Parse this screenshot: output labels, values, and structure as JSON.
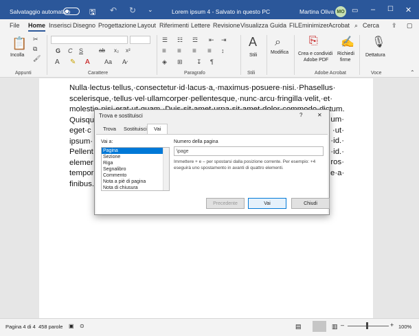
{
  "titlebar": {
    "autosave_label": "Salvataggio automatico",
    "doc_title": "Lorem ipsum 4  -  Salvato in questo PC",
    "user_name": "Martina Oliva",
    "user_initials": "MO"
  },
  "tabs": [
    "File",
    "Home",
    "Inserisci",
    "Disegno",
    "Progettazione",
    "Layout",
    "Riferimenti",
    "Lettere",
    "Revisione",
    "Visualizza",
    "Guida",
    "FILEminimizer",
    "Acrobat",
    "Cerca"
  ],
  "active_tab": "Home",
  "ribbon": {
    "paste_label": "Incolla",
    "groups": {
      "clipboard": "Appunti",
      "font": "Carattere",
      "paragraph": "Paragrafo",
      "styles_grp": "Stili",
      "acrobat": "Adobe Acrobat",
      "voice": "Voce"
    },
    "styles_label": "Stili",
    "edit_label": "Modifica",
    "create_pdf": "Crea e condividi",
    "create_pdf2": "Adobe PDF",
    "request_sign": "Richiedi",
    "request_sign2": "firme",
    "dictate": "Dettatura"
  },
  "document": {
    "lines": [
      "Nulla·lectus·tellus,·consectetur·id·lacus·a,·maximus·posuere·nisi.·Phasellus·",
      "scelerisque,·tellus·vel·ullamcorper·pellentesque,·nunc·arcu·fringilla·velit,·et·",
      "molestie·nisi·erat·ut·quam.·Duis·sit·amet·urna·sit·amet·dolor·commodo·dictum.·",
      "Quisque",
      "eget·c",
      "ipsum·",
      "Pellent",
      "elemer",
      "tempor",
      "finibus."
    ],
    "right_frags": [
      "um·",
      "·ut·",
      "·id.·",
      "·id.·",
      "ros·",
      "e·a·"
    ]
  },
  "dialog": {
    "title": "Trova e sostituisci",
    "help_q": "?",
    "close": "✕",
    "tabs": [
      "Trova",
      "Sostituisci",
      "Vai"
    ],
    "goto_label": "Vai a:",
    "list_items": [
      "Pagina",
      "Sezione",
      "Riga",
      "Segnalibro",
      "Commento",
      "Nota a piè di pagina",
      "Nota di chiusura"
    ],
    "selected_item": "Pagina",
    "page_number_label": "Numero della pagina",
    "page_number_value": "\\page",
    "help_text": "Immettere + e – per spostarsi dalla posizione corrente. Per esempio: +4 eseguirà uno spostamento in avanti di quattro elementi.",
    "btn_prev": "Precedente",
    "btn_go": "Vai",
    "btn_close": "Chiudi"
  },
  "statusbar": {
    "page": "Pagina 4 di 4",
    "words": "458 parole",
    "zoom": "100%",
    "zoom_minus": "–",
    "zoom_plus": "+"
  },
  "colors": {
    "accent": "#2b579a",
    "selection": "#0078d7"
  }
}
